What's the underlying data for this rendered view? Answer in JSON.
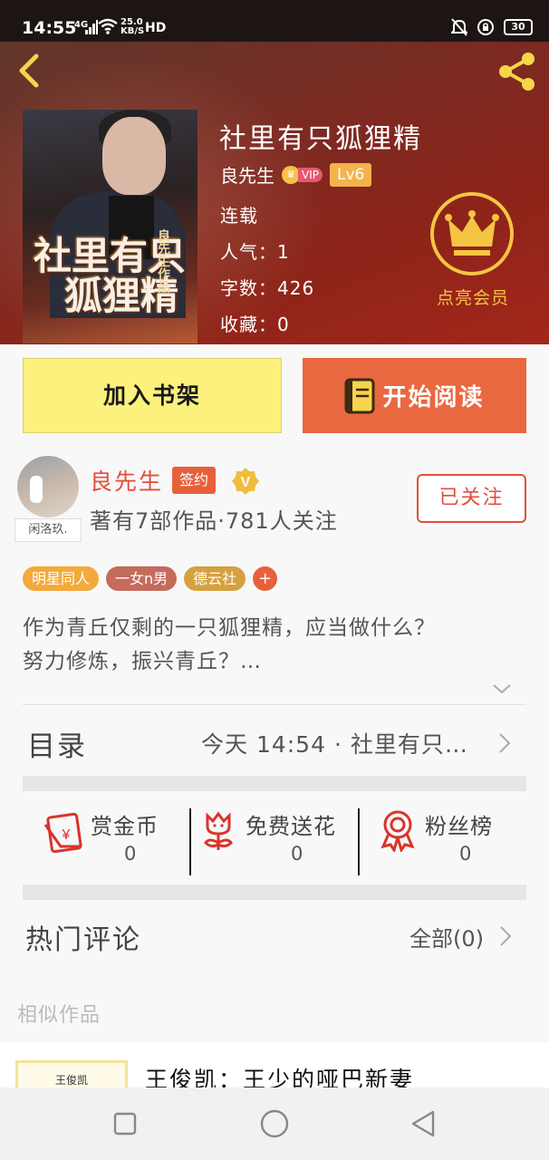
{
  "status_bar": {
    "time": "14:55",
    "signal": "4G",
    "speed": "25.0 KB/S",
    "hd": "HD",
    "battery": "30"
  },
  "header": {
    "cover": {
      "title_line1": "社里有只",
      "title_line2": "狐狸精",
      "author_mark": "良先生作品"
    },
    "book_title": "社里有只狐狸精",
    "author": "良先生",
    "vip_label": "VIP",
    "level": "Lv6",
    "status": "连载",
    "popularity": "人气：1",
    "word_count": "字数：426",
    "favorites": "收藏：0",
    "member_label": "点亮会员",
    "colors": {
      "accent_gold": "#f5c542",
      "header_red": "#8d2419"
    }
  },
  "actions": {
    "add_to_shelf": "加入书架",
    "start_reading": "开始阅读"
  },
  "writer": {
    "avatar_caption": "闲洛玖.",
    "name": "良先生",
    "signed": "签约",
    "stats": "著有7部作品·781人关注",
    "follow_label": "已关注"
  },
  "tags": [
    {
      "label": "明星同人",
      "color": "#f3a93b"
    },
    {
      "label": "一女n男",
      "color": "#c46b5c"
    },
    {
      "label": "德云社",
      "color": "#d6a13f"
    },
    {
      "label": "+",
      "color": "#e8603a"
    }
  ],
  "intro": {
    "line1": "作为青丘仅剩的一只狐狸精，应当做什么？",
    "line2": "努力修炼，振兴青丘？…"
  },
  "catalog": {
    "title": "目录",
    "latest": "今天 14:54 · 社里有只…"
  },
  "rewards": [
    {
      "label": "赏金币",
      "count": "0",
      "icon": "coin-envelope-icon"
    },
    {
      "label": "免费送花",
      "count": "0",
      "icon": "flower-icon"
    },
    {
      "label": "粉丝榜",
      "count": "0",
      "icon": "medal-icon"
    }
  ],
  "comments": {
    "title": "热门评论",
    "all_label": "全部(0)"
  },
  "similar": {
    "title": "相似作品",
    "items": [
      {
        "thumb_text": "王俊凯",
        "name": "王俊凯：王少的哑巴新妻"
      }
    ]
  }
}
